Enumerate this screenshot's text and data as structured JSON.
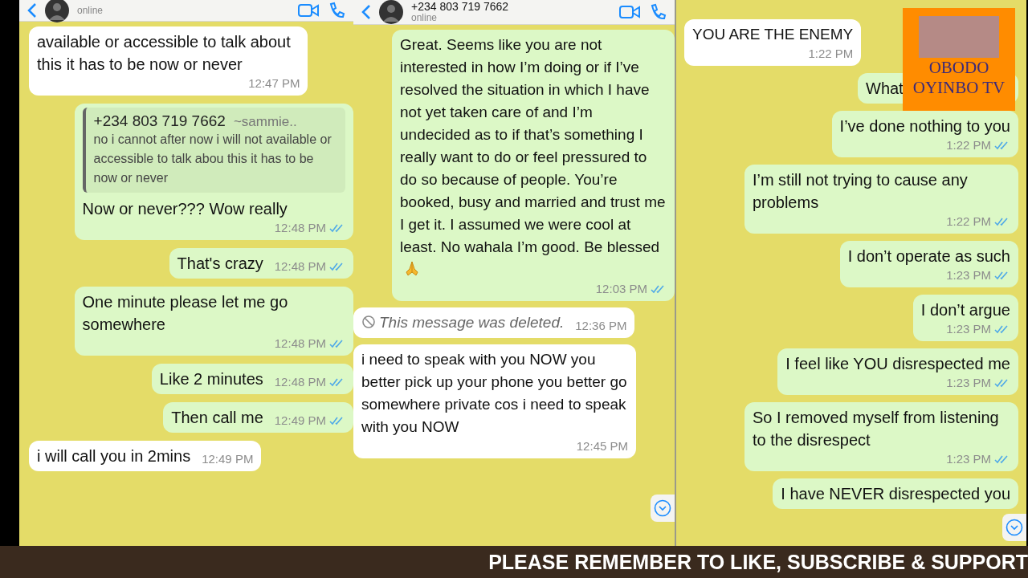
{
  "panels": [
    {
      "header": {
        "status": "online"
      },
      "scroll_down_button": false,
      "messages": [
        {
          "kind": "in",
          "text": "available or accessible to talk about this it has to be now or never",
          "time": "12:47 PM"
        },
        {
          "kind": "out",
          "quote": {
            "author": "+234 803 719 7662",
            "alias": "~sammie..",
            "text": "no i cannot after now i will not available or accessible to talk abou this it has to be now or never"
          },
          "text": "Now or never??? Wow really",
          "time": "12:48 PM",
          "read": true
        },
        {
          "kind": "out",
          "text": "That's crazy",
          "time": "12:48 PM",
          "read": true
        },
        {
          "kind": "out",
          "text": "One minute please let me go somewhere",
          "time": "12:48 PM",
          "read": true
        },
        {
          "kind": "out",
          "text": "Like 2 minutes",
          "time": "12:48 PM",
          "read": true
        },
        {
          "kind": "out",
          "text": "Then call me",
          "time": "12:49 PM",
          "read": true
        },
        {
          "kind": "in",
          "text": "i will call you in 2mins",
          "time": "12:49 PM"
        }
      ]
    },
    {
      "header": {
        "name": "+234 803 719 7662",
        "status": "online"
      },
      "scroll_down_button": true,
      "messages": [
        {
          "kind": "out",
          "text": "Great. Seems like you are not interested in how I’m doing or if I’ve resolved the situation in which I have not yet taken care of and I’m undecided as to if that’s something I really want to do or feel pressured to do so because of people. You’re booked, busy and married and trust me I get it. I assumed we were cool at least. No wahala I’m good.  Be blessed",
          "trailing_emoji": true,
          "time": "12:03 PM",
          "read": true
        },
        {
          "kind": "deleted",
          "text": "This message was deleted.",
          "time": "12:36 PM"
        },
        {
          "kind": "in",
          "text": "i need to speak with you NOW you better pick up your phone you better go somewhere private cos i need to speak with you NOW",
          "time": "12:45 PM"
        }
      ]
    },
    {
      "scroll_down_button": true,
      "messages": [
        {
          "kind": "in",
          "text": "YOU ARE THE ENEMY",
          "time": "1:22 PM"
        },
        {
          "kind": "out",
          "text": "What"
        },
        {
          "kind": "out",
          "text": "I’ve done nothing to you",
          "time": "1:22 PM",
          "read": true
        },
        {
          "kind": "out",
          "text": "I’m still not trying to cause any problems",
          "time": "1:22 PM",
          "read": true
        },
        {
          "kind": "out",
          "text": "I don’t operate as such",
          "time": "1:23 PM",
          "read": true
        },
        {
          "kind": "out",
          "text": "I don’t argue",
          "time": "1:23 PM",
          "read": true
        },
        {
          "kind": "out",
          "text": "I feel like YOU disrespected me",
          "time": "1:23 PM",
          "read": true
        },
        {
          "kind": "out",
          "text": "So I removed myself from listening to the disrespect",
          "time": "1:23 PM",
          "read": true
        },
        {
          "kind": "out",
          "text": "I have NEVER disrespected you"
        }
      ]
    }
  ],
  "logo": {
    "title": "OBODO OYINBO TV"
  },
  "banner": {
    "text": "PLEASE REMEMBER TO LIKE, SUBSCRIBE & SUPPORT"
  }
}
